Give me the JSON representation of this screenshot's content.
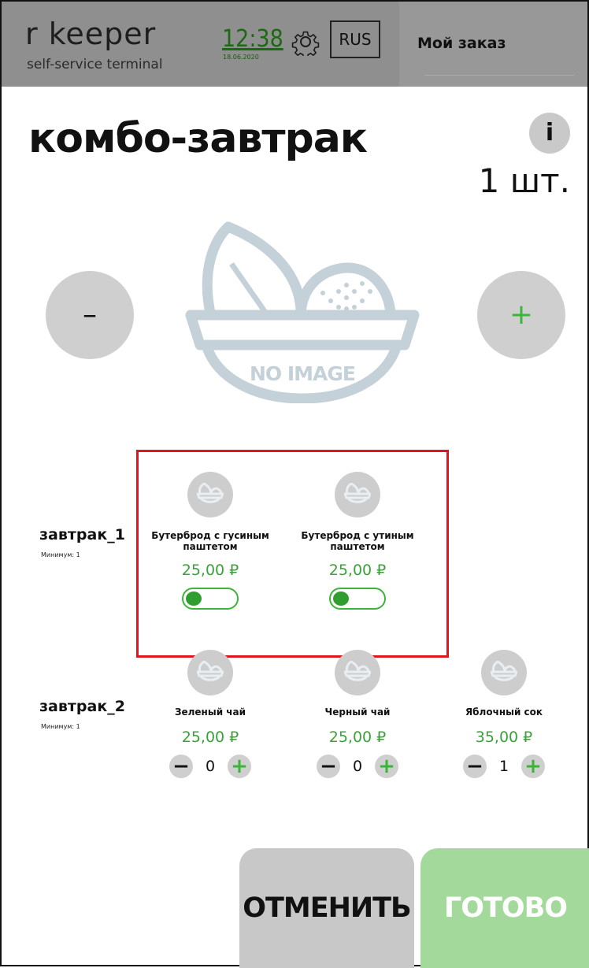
{
  "header": {
    "logo_main": "r  keeper",
    "logo_sub": "self-service terminal",
    "time": "12:38",
    "date": "18.06.2020",
    "language": "RUS",
    "order_title": "Мой заказ"
  },
  "product": {
    "title": "комбо-завтрак",
    "info_label": "i",
    "quantity": "1 шт.",
    "minus_label": "–",
    "plus_label": "+",
    "image_text": "NO IMAGE"
  },
  "groups": [
    {
      "name": "завтрак_1",
      "minimum": "Минимум: 1",
      "items": [
        {
          "name_line1": "Бутерброд с гусиным",
          "name_line2": "паштетом",
          "price": "25,00 ₽",
          "toggle": "off"
        },
        {
          "name_line1": "Бутерброд с утиным",
          "name_line2": "паштетом",
          "price": "25,00 ₽",
          "toggle": "off"
        }
      ]
    },
    {
      "name": "завтрак_2",
      "minimum": "Минимум: 1",
      "items": [
        {
          "name": "Зеленый чай",
          "price": "25,00 ₽",
          "count": "0"
        },
        {
          "name": "Черный чай",
          "price": "25,00 ₽",
          "count": "0"
        },
        {
          "name": "Яблочный сок",
          "price": "35,00 ₽",
          "count": "1"
        }
      ]
    }
  ],
  "stepper": {
    "minus": "−",
    "plus": "+"
  },
  "actions": {
    "cancel": "ОТМЕНИТЬ",
    "done": "ГОТОВО"
  },
  "colors": {
    "header": "#8f8f8f",
    "accent_green": "#3ab53a",
    "highlight_red": "#e0161f",
    "done_bg": "#a3d99a"
  }
}
